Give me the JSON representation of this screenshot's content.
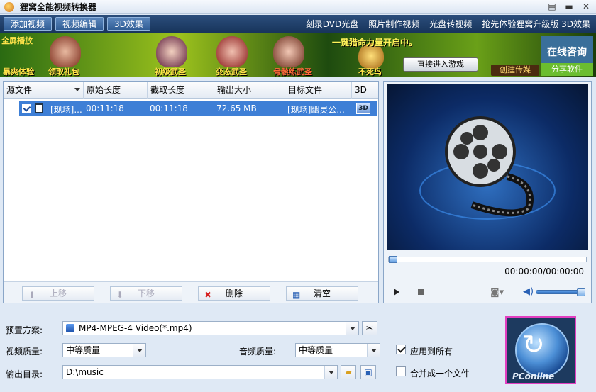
{
  "window": {
    "title": "狸窝全能视频转换器",
    "min_icon": "▤",
    "max_icon": "▬",
    "close_icon": "✕"
  },
  "toolbar": {
    "buttons": [
      "添加视频",
      "视频编辑",
      "3D效果"
    ],
    "links": [
      "刻录DVD光盘",
      "照片制作视频",
      "光盘转视频",
      "抢先体验狸窝升级版 3D效果"
    ]
  },
  "banner": {
    "fullscreen": "全屏播放",
    "ads": [
      "暴爽体验",
      "领取礼包",
      "初级武圣",
      "变态武圣",
      "骨骸练武圣"
    ],
    "slogan": "一键猎命力量开启中。",
    "not_die": "不死鸟",
    "play_button": "直接进入游戏",
    "create_button": "创建传媒",
    "consult": "在线咨询",
    "share": "分享软件"
  },
  "file_list": {
    "columns": [
      "源文件",
      "原始长度",
      "截取长度",
      "输出大小",
      "目标文件",
      "3D"
    ],
    "rows": [
      {
        "source": "[现场]...",
        "original_length": "00:11:18",
        "clip_length": "00:11:18",
        "output_size": "72.65 MB",
        "target": "[现场]幽灵公...",
        "badge": "3D"
      }
    ],
    "buttons": {
      "up": "上移",
      "down": "下移",
      "delete": "删除",
      "clear": "清空"
    }
  },
  "preview": {
    "timecode": "00:00:00/00:00:00"
  },
  "settings": {
    "preset_label": "预置方案:",
    "preset_value": "MP4-MPEG-4 Video(*.mp4)",
    "video_quality_label": "视频质量:",
    "video_quality_value": "中等质量",
    "audio_quality_label": "音频质量:",
    "audio_quality_value": "中等质量",
    "apply_all_label": "应用到所有",
    "output_dir_label": "输出目录:",
    "output_dir_value": "D:\\music",
    "merge_label": "合并成一个文件",
    "watermark": "PConline"
  }
}
